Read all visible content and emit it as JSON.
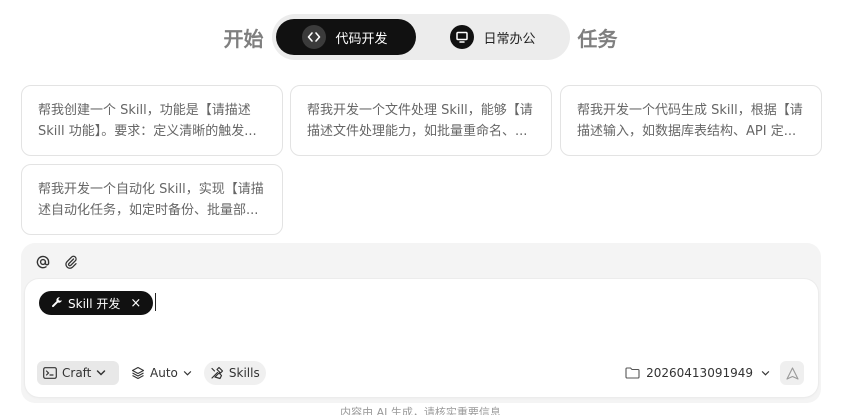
{
  "mode_switch": {
    "left_word": "开始",
    "right_word": "任务",
    "tabs": [
      {
        "label": "代码开发",
        "active": true,
        "icon": "code-icon"
      },
      {
        "label": "日常办公",
        "active": false,
        "icon": "monitor-icon"
      }
    ]
  },
  "suggestions": [
    {
      "line1": "帮我创建一个 Skill，功能是【请描述",
      "line2": "Skill 功能】。要求：定义清晰的触发..."
    },
    {
      "line1": "帮我开发一个文件处理 Skill，能够【请",
      "line2": "描述文件处理能力，如批量重命名、..."
    },
    {
      "line1": "帮我开发一个代码生成 Skill，根据【请",
      "line2": "描述输入，如数据库表结构、API 定..."
    },
    {
      "line1": "帮我开发一个自动化 Skill，实现【请描",
      "line2": "述自动化任务，如定时备份、批量部..."
    }
  ],
  "composer": {
    "toolbar_icons": [
      "at-icon",
      "paperclip-icon"
    ],
    "chip_label": "Skill 开发",
    "chip_close": "×",
    "mode_button": "Craft",
    "model_button": "Auto",
    "skills_button": "Skills",
    "workspace_folder": "20260413091949",
    "send_icon": "send-icon"
  },
  "footer": {
    "disclaimer": "内容由 AI 生成，请核实重要信息"
  }
}
